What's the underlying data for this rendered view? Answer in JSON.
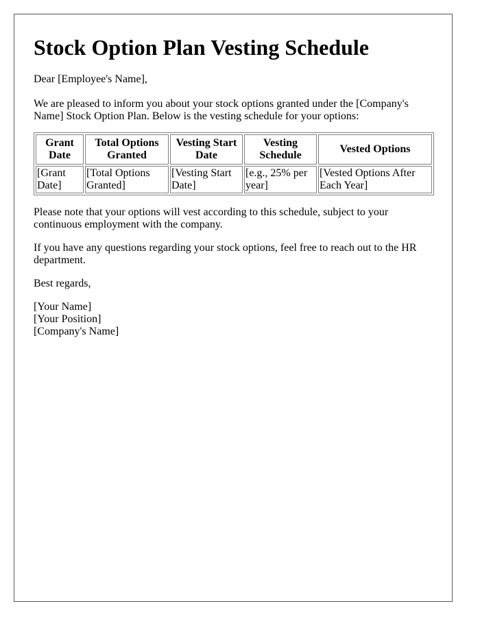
{
  "document": {
    "title": "Stock Option Plan Vesting Schedule",
    "greeting": "Dear [Employee's Name],",
    "intro": "We are pleased to inform you about your stock options granted under the [Company's Name] Stock Option Plan. Below is the vesting schedule for your options:",
    "table": {
      "headers": [
        "Grant Date",
        "Total Options Granted",
        "Vesting Start Date",
        "Vesting Schedule",
        "Vested Options"
      ],
      "rows": [
        [
          "[Grant Date]",
          "[Total Options Granted]",
          "[Vesting Start Date]",
          "[e.g., 25% per year]",
          "[Vested Options After Each Year]"
        ]
      ]
    },
    "note": "Please note that your options will vest according to this schedule, subject to your continuous employment with the company.",
    "questions": "If you have any questions regarding your stock options, feel free to reach out to the HR department.",
    "closing": "Best regards,",
    "signature": {
      "name": "[Your Name]",
      "position": "[Your Position]",
      "company": "[Company's Name]"
    }
  }
}
